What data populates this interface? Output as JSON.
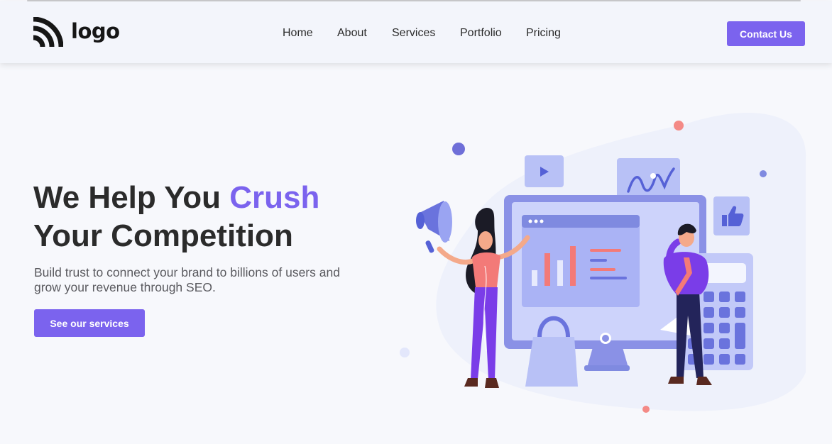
{
  "brand": {
    "name": "logo"
  },
  "nav": {
    "items": [
      "Home",
      "About",
      "Services",
      "Portfolio",
      "Pricing"
    ],
    "cta_label": "Contact Us"
  },
  "hero": {
    "title_part1": "We Help You ",
    "title_accent": "Crush",
    "title_part2": "Your Competition",
    "subtitle": "Build trust to connect your brand to billions of users and grow your revenue through SEO.",
    "cta_label": "See our services"
  },
  "icons": {
    "logo": "signal-arcs-icon",
    "play": "play-icon",
    "chart": "bar-chart-icon",
    "wave": "wave-chart-icon",
    "like": "thumbs-up-icon",
    "megaphone": "megaphone-icon"
  },
  "colors": {
    "accent": "#7b63ee",
    "background": "#f7f8fc",
    "navbar": "#f3f5fb",
    "text": "#2b2b2b",
    "illustration_light": "#b9c0f5",
    "illustration_mid": "#7f8ae0",
    "coral": "#f37a78"
  }
}
